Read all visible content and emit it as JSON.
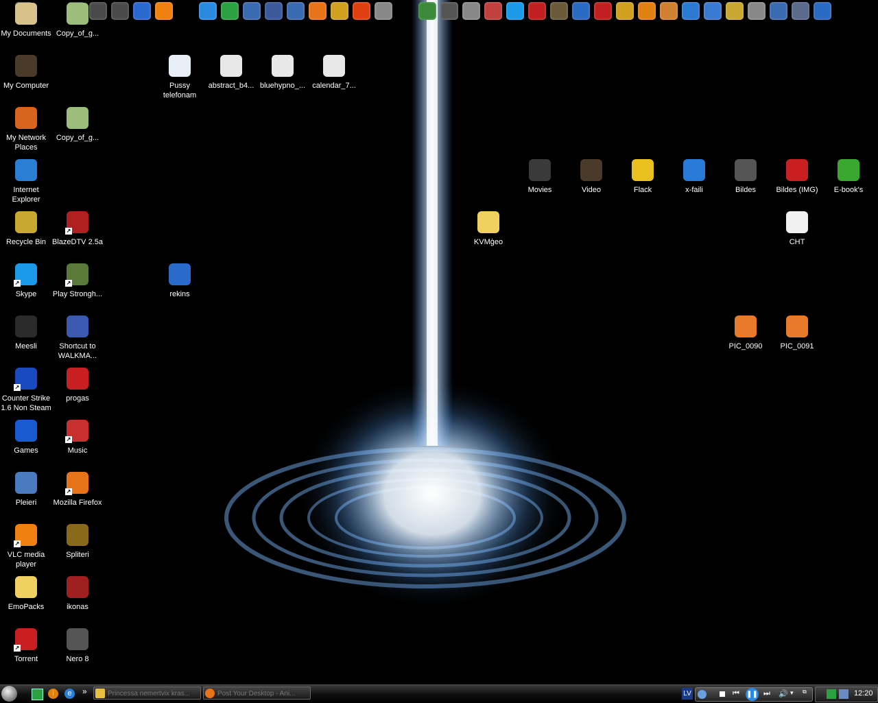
{
  "desktop": {
    "icons": [
      {
        "label": "My Documents",
        "icon": "my-documents-icon",
        "color": "#d9c28a"
      },
      {
        "label": "Copy_of_g...",
        "icon": "spreadsheet-file-icon",
        "color": "#9bbf7a"
      },
      {
        "label": "My Computer",
        "icon": "my-computer-icon",
        "color": "#4a3a2a"
      },
      {
        "label": "Pussy telefonam",
        "icon": "mp3-file-icon",
        "color": "#e8eef5"
      },
      {
        "label": "abstract_b4...",
        "icon": "image-file-icon",
        "color": "#e8e8e8"
      },
      {
        "label": "bluehypno_...",
        "icon": "image-file-icon",
        "color": "#e8e8e8"
      },
      {
        "label": "calendar_7...",
        "icon": "image-file-icon",
        "color": "#e8e8e8"
      },
      {
        "label": "My Network Places",
        "icon": "network-places-icon",
        "color": "#d8641e"
      },
      {
        "label": "Copy_of_g...",
        "icon": "spreadsheet-file-icon",
        "color": "#9bbf7a"
      },
      {
        "label": "Internet Explorer",
        "icon": "internet-explorer-icon",
        "color": "#2a7fd4"
      },
      {
        "label": "Movies",
        "icon": "folder-icon",
        "color": "#3a3a3a"
      },
      {
        "label": "Video",
        "icon": "video-folder-icon",
        "color": "#4a3a2a"
      },
      {
        "label": "Flack",
        "icon": "folder-icon",
        "color": "#e8c020"
      },
      {
        "label": "x-faili",
        "icon": "folder-icon",
        "color": "#2a7ad8"
      },
      {
        "label": "Bildes",
        "icon": "folder-icon",
        "color": "#555"
      },
      {
        "label": "Bildes (IMG)",
        "icon": "folder-icon",
        "color": "#c82020"
      },
      {
        "label": "E-book's",
        "icon": "folder-icon",
        "color": "#3aa830"
      },
      {
        "label": "Recycle Bin",
        "icon": "recycle-bin-icon",
        "color": "#c8a830"
      },
      {
        "label": "BlazeDTV 2.5a",
        "icon": "tv-icon",
        "color": "#b02020"
      },
      {
        "label": "KVMģeo",
        "icon": "folder-icon",
        "color": "#f0d060"
      },
      {
        "label": "CHT",
        "icon": "text-file-icon",
        "color": "#f0f0f0"
      },
      {
        "label": "Skype",
        "icon": "skype-icon",
        "color": "#1a9ae8"
      },
      {
        "label": "Play Strongh...",
        "icon": "game-icon",
        "color": "#5a7a3a"
      },
      {
        "label": "rekins",
        "icon": "feather-icon",
        "color": "#2a6ac8"
      },
      {
        "label": "Meesli",
        "icon": "app-icon",
        "color": "#2a2a2a"
      },
      {
        "label": "Shortcut to WALKMA...",
        "icon": "walkman-icon",
        "color": "#3a5ab0"
      },
      {
        "label": "PIC_0090",
        "icon": "image-file-icon",
        "color": "#e87a2a"
      },
      {
        "label": "PIC_0091",
        "icon": "image-file-icon",
        "color": "#e87a2a"
      },
      {
        "label": "Counter Strike 1.6 Non Steam",
        "icon": "counter-strike-icon",
        "color": "#1a4ac0"
      },
      {
        "label": "progas",
        "icon": "program-icon",
        "color": "#c82020"
      },
      {
        "label": "Games",
        "icon": "games-icon",
        "color": "#1a5ad0"
      },
      {
        "label": "Music",
        "icon": "music-icon",
        "color": "#c83030"
      },
      {
        "label": "Pleieri",
        "icon": "player-icon",
        "color": "#4a7ac0"
      },
      {
        "label": "Mozilla Firefox",
        "icon": "firefox-icon",
        "color": "#e8741a"
      },
      {
        "label": "VLC media player",
        "icon": "vlc-icon",
        "color": "#f08010"
      },
      {
        "label": "Spliteri",
        "icon": "splitter-icon",
        "color": "#8a6a1a"
      },
      {
        "label": "EmoPacks",
        "icon": "folder-icon",
        "color": "#f0d060"
      },
      {
        "label": "ikonas",
        "icon": "icons-folder-icon",
        "color": "#a02020"
      },
      {
        "label": "Torrent",
        "icon": "torrent-icon",
        "color": "#c82020"
      },
      {
        "label": "Nero 8",
        "icon": "nero-icon",
        "color": "#555"
      }
    ]
  },
  "topbar": {
    "icons": [
      {
        "icon": "documents-icon",
        "color": "#5a5a5a"
      },
      {
        "icon": "folder-icon",
        "color": "#4a4a4a"
      },
      {
        "icon": "folder-icon",
        "color": "#4a4a4a"
      },
      {
        "icon": "folder-icon",
        "color": "#4a4a4a"
      },
      {
        "icon": "media-player-icon",
        "color": "#2a6ad0"
      },
      {
        "icon": "vlc-icon",
        "color": "#f08010"
      },
      {
        "icon": "messenger-icon",
        "color": "#2a8ae0"
      },
      {
        "icon": "green-app-icon",
        "color": "#2aa040"
      },
      {
        "icon": "network-icon",
        "color": "#3a6ab0"
      },
      {
        "icon": "gear-icon",
        "color": "#3a5a9a"
      },
      {
        "icon": "search-icon",
        "color": "#3a6ab0"
      },
      {
        "icon": "firefox-icon",
        "color": "#e8741a"
      },
      {
        "icon": "help-icon",
        "color": "#d0a020"
      },
      {
        "icon": "half-life-icon",
        "color": "#e04010"
      },
      {
        "icon": "help-icon",
        "color": "#888"
      },
      {
        "icon": "disc-icon",
        "color": "#3a8a3a"
      },
      {
        "icon": "disc-icon",
        "color": "#555"
      },
      {
        "icon": "film-icon",
        "color": "#888"
      },
      {
        "icon": "paint-icon",
        "color": "#c04040"
      },
      {
        "icon": "skype-icon",
        "color": "#1a9ae8"
      },
      {
        "icon": "acrobat-icon",
        "color": "#c02020"
      },
      {
        "icon": "gimp-icon",
        "color": "#6a5a3a"
      },
      {
        "icon": "help-icon",
        "color": "#2a6ac0"
      },
      {
        "icon": "red-app-icon",
        "color": "#c02020"
      },
      {
        "icon": "tools-icon",
        "color": "#d0a020"
      },
      {
        "icon": "info-icon",
        "color": "#e08010"
      },
      {
        "icon": "paint-icon",
        "color": "#d08030"
      },
      {
        "icon": "settings-icon",
        "color": "#2a7ad0"
      },
      {
        "icon": "network-icon",
        "color": "#3a7ad0"
      },
      {
        "icon": "trash-icon",
        "color": "#c8a830"
      },
      {
        "icon": "clock-icon",
        "color": "#888"
      },
      {
        "icon": "mail-icon",
        "color": "#3a6ab0"
      },
      {
        "icon": "document-icon",
        "color": "#5a6a8a"
      },
      {
        "icon": "window-icon",
        "color": "#2a6ac0"
      }
    ]
  },
  "taskbar": {
    "tasks": [
      {
        "label": "Princessa nemertvix kras..."
      },
      {
        "label": "Post Your Desktop - Ani..."
      }
    ],
    "quicklaunch_more": "»",
    "language": "LV",
    "clock": "12:20"
  },
  "colors": {
    "accent": "#5ea8ff",
    "beam": "#bfe0ff"
  }
}
